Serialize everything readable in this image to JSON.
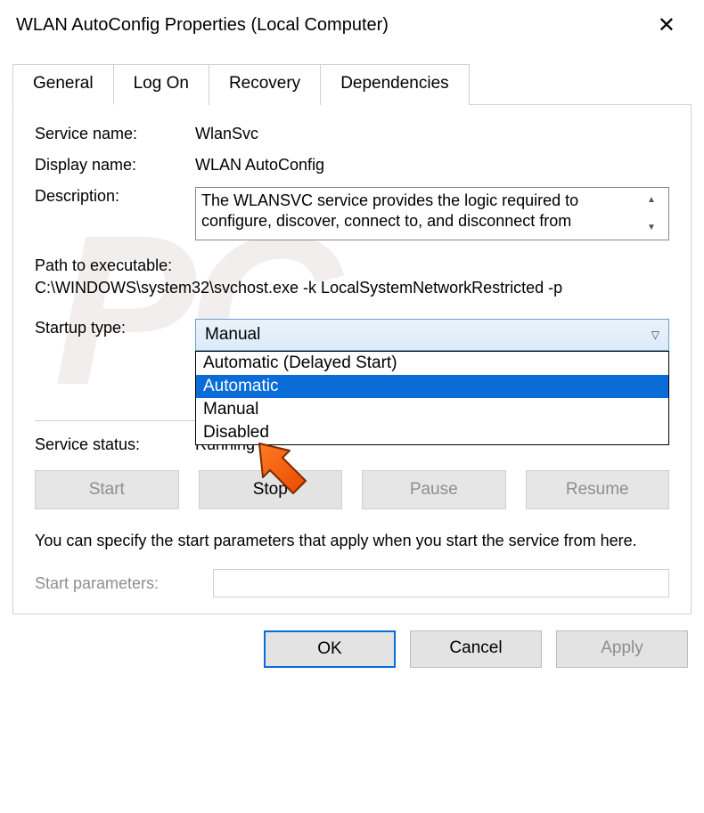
{
  "window": {
    "title": "WLAN AutoConfig Properties (Local Computer)"
  },
  "tabs": {
    "general": "General",
    "logon": "Log On",
    "recovery": "Recovery",
    "dependencies": "Dependencies"
  },
  "fields": {
    "service_name_label": "Service name:",
    "service_name_value": "WlanSvc",
    "display_name_label": "Display name:",
    "display_name_value": "WLAN AutoConfig",
    "description_label": "Description:",
    "description_value": "The WLANSVC service provides the logic required to configure, discover, connect to, and disconnect from",
    "path_label": "Path to executable:",
    "path_value": "C:\\WINDOWS\\system32\\svchost.exe -k LocalSystemNetworkRestricted -p",
    "startup_label": "Startup type:",
    "startup_selected": "Manual",
    "dropdown": {
      "opt1": "Automatic (Delayed Start)",
      "opt2": "Automatic",
      "opt3": "Manual",
      "opt4": "Disabled"
    },
    "status_label": "Service status:",
    "status_value": "Running",
    "help_text": "You can specify the start parameters that apply when you start the service from here.",
    "start_params_label": "Start parameters:"
  },
  "buttons": {
    "start": "Start",
    "stop": "Stop",
    "pause": "Pause",
    "resume": "Resume",
    "ok": "OK",
    "cancel": "Cancel",
    "apply": "Apply"
  },
  "watermark": "PC"
}
